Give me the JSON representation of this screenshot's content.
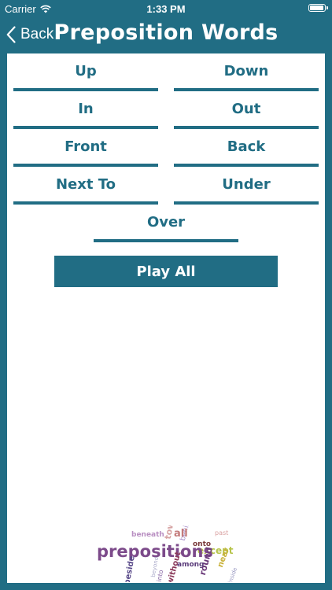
{
  "status_bar": {
    "carrier": "Carrier",
    "time": "1:33 PM"
  },
  "nav": {
    "back_label": "Back",
    "title": "Preposition Words"
  },
  "words": [
    {
      "label": "Up"
    },
    {
      "label": "Down"
    },
    {
      "label": "In"
    },
    {
      "label": "Out"
    },
    {
      "label": "Front"
    },
    {
      "label": "Back"
    },
    {
      "label": "Next To"
    },
    {
      "label": "Under"
    },
    {
      "label": "Over"
    }
  ],
  "play_all_label": "Play All",
  "word_cloud": {
    "words": [
      "prepositions",
      "except",
      "beneath",
      "without",
      "among",
      "beside",
      "toward",
      "onto",
      "near",
      "behind",
      "all",
      "past",
      "beyond",
      "round",
      "into",
      "inside"
    ]
  },
  "colors": {
    "primary": "#216d84",
    "content_bg": "#ffffff",
    "status_text": "#ffffff"
  }
}
